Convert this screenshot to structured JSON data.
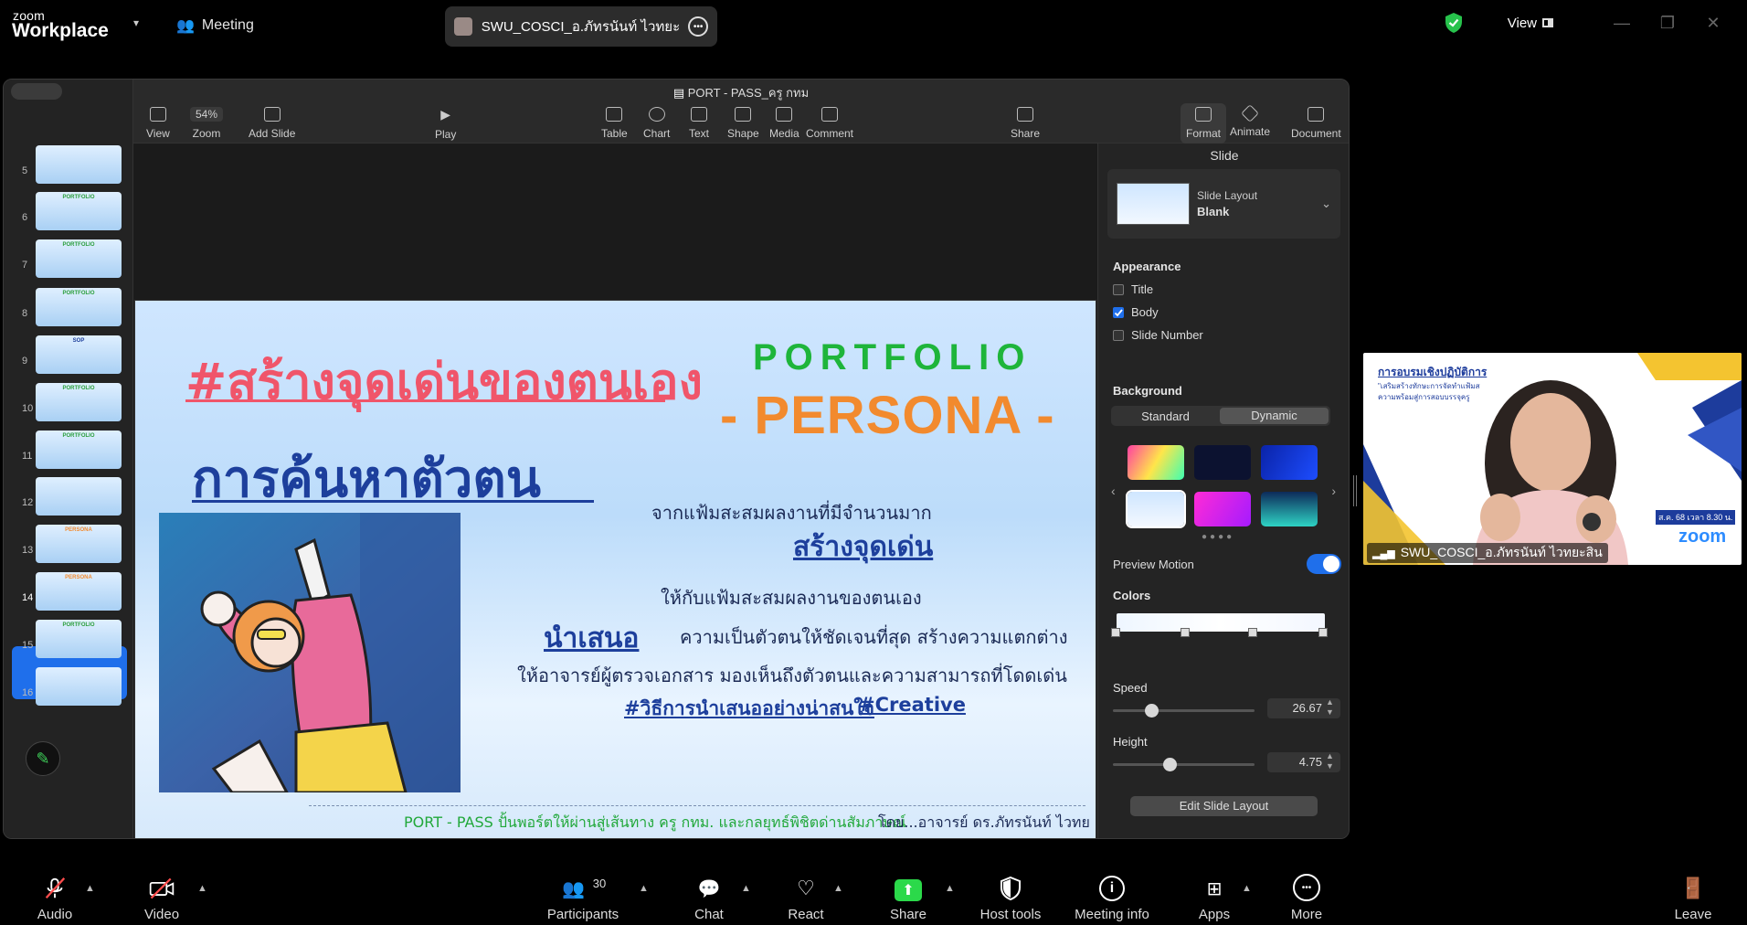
{
  "zoom": {
    "brand_small": "zoom",
    "brand_big": "Workplace",
    "meeting_label": "Meeting",
    "share_title": "SWU_COSCI_อ.ภัทรนันท์ ไวทยะสิน's s",
    "view_label": "View",
    "participant_count": "30"
  },
  "pages": {
    "doc_title": "PORT - PASS_ครู กทม",
    "zoom_value": "54%",
    "toolbar": {
      "view": "View",
      "zoom": "Zoom",
      "add_slide": "Add Slide",
      "play": "Play",
      "table": "Table",
      "chart": "Chart",
      "text": "Text",
      "shape": "Shape",
      "media": "Media",
      "comment": "Comment",
      "share": "Share",
      "format": "Format",
      "animate": "Animate",
      "document": "Document"
    },
    "slide_numbers": [
      "5",
      "6",
      "7",
      "8",
      "9",
      "10",
      "11",
      "12",
      "13",
      "14",
      "15",
      "16"
    ],
    "thumbs": [
      "",
      "PORTFOLIO",
      "PORTFOLIO",
      "PORTFOLIO",
      "SOP",
      "PORTFOLIO",
      "PORTFOLIO",
      "",
      "PERSONA",
      "PERSONA",
      "PORTFOLIO",
      ""
    ]
  },
  "slide": {
    "h1": "#สร้างจุดเด่นของตนเอง",
    "h2": "การค้นหาตัวตน",
    "portfolio": "PORTFOLIO",
    "persona": "- PERSONA -",
    "line1": "จากแฟ้มสะสมผลงานที่มีจำนวนมาก",
    "line2": "สร้างจุดเด่น",
    "line3": "ให้กับแฟ้มสะสมผลงานของตนเอง",
    "line4_big": "นำเสนอ",
    "line4": "ความเป็นตัวตนให้ชัดเจนที่สุด สร้างความแตกต่าง",
    "line5": "ให้อาจารย์ผู้ตรวจเอกสาร มองเห็นถึงตัวตนและความสามารถที่โดดเด่น",
    "tag1": "#วิธีการนำเสนออย่างน่าสนใจ",
    "tag2": "#Creative",
    "footer1": "PORT - PASS ปั้นพอร์ตให้ผ่านสู่เส้นทาง ครู กทม. และกลยุทธ์พิชิตด่านสัมภาษณ์",
    "footer2": "โดย...อาจารย์ ดร.ภัทรนันท์ ไวทยะสิน"
  },
  "inspector": {
    "tab": "Slide",
    "layout_label": "Slide Layout",
    "layout_value": "Blank",
    "appearance": "Appearance",
    "title": "Title",
    "body": "Body",
    "slide_number": "Slide Number",
    "background": "Background",
    "standard": "Standard",
    "dynamic": "Dynamic",
    "preview_motion": "Preview Motion",
    "colors": "Colors",
    "speed": "Speed",
    "speed_value": "26.67",
    "speed_fraction": 0.27,
    "height": "Height",
    "height_value": "4.75",
    "height_fraction": 0.4,
    "edit_layout": "Edit Slide Layout"
  },
  "video": {
    "name": "SWU_COSCI_อ.ภัทรนันท์ ไวทยะสิน",
    "poster_title": "การอบรมเชิงปฏิบัติการ",
    "poster_sub1": "\"เสริมสร้างทักษะการจัดทำแฟ้มส",
    "poster_sub2": "ความพร้อมสู่การสอบบรรจุครู",
    "poster_date": "ส.ค. 68 เวลา 8.30 น.",
    "poster_brand": "zoom"
  },
  "bottombar": {
    "audio": "Audio",
    "video": "Video",
    "participants": "Participants",
    "chat": "Chat",
    "react": "React",
    "share": "Share",
    "host_tools": "Host tools",
    "meeting_info": "Meeting info",
    "apps": "Apps",
    "more": "More",
    "leave": "Leave"
  },
  "colors": {
    "accent": "#1f6feb",
    "share_green": "#2bd94a",
    "persona_orange": "#f28a2e",
    "portfolio_green": "#1eb53a",
    "heading_pink": "#f0556a"
  }
}
